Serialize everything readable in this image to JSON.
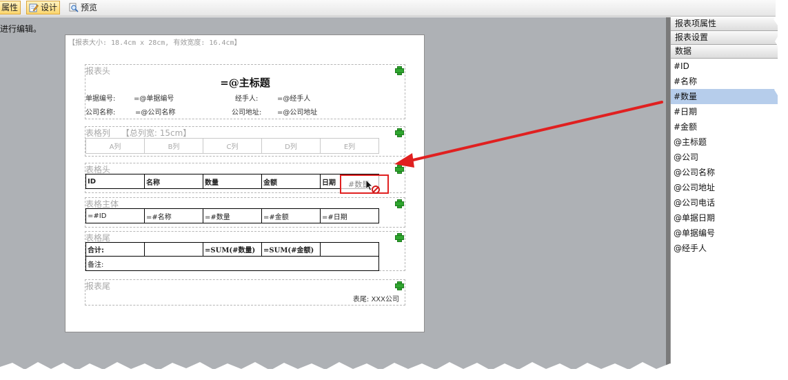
{
  "toolbar": {
    "properties_label": "属性",
    "design_label": "设计",
    "preview_label": "预览"
  },
  "hint_text": "进行编辑。",
  "paper": {
    "size_text": "【报表大小: 18.4cm x 28cm, 有效宽度: 16.4cm】"
  },
  "report_header": {
    "label": "报表头",
    "title": "=@主标题",
    "doc_no_label": "单据编号:",
    "doc_no_value": "=@单据编号",
    "handler_label": "经手人:",
    "handler_value": "=@经手人",
    "company_label": "公司名称:",
    "company_value": "=@公司名称",
    "address_label": "公司地址:",
    "address_value": "=@公司地址"
  },
  "table_columns": {
    "label": "表格列",
    "total_width": "【总列宽: 15cm】",
    "columns": [
      "A列",
      "B列",
      "C列",
      "D列",
      "E列"
    ]
  },
  "table_header": {
    "label": "表格头",
    "cells": [
      "ID",
      "名称",
      "数量",
      "金额",
      "日期"
    ]
  },
  "table_body": {
    "label": "表格主体",
    "cells": [
      "=#ID",
      "=#名称",
      "=#数量",
      "=#金额",
      "=#日期"
    ]
  },
  "table_footer": {
    "label": "表格尾",
    "cells": [
      "合计:",
      "",
      "=SUM(#数量)",
      "=SUM(#金额)",
      ""
    ],
    "note": "备注:"
  },
  "report_footer": {
    "label": "报表尾",
    "text": "表尾: XXX公司"
  },
  "drag_item": "#数量",
  "panel": {
    "headers": [
      "报表项属性",
      "报表设置",
      "数据"
    ],
    "items": [
      "#ID",
      "#名称",
      "#数量",
      "#日期",
      "#金额",
      "@主标题",
      "@公司",
      "@公司名称",
      "@公司地址",
      "@公司电话",
      "@单据日期",
      "@单据编号",
      "@经手人"
    ],
    "selected_index": 2
  },
  "colors": {
    "annotation_red": "#e02020",
    "selection": "#b6cdeb",
    "canvas_gray": "#aeb1b5"
  }
}
